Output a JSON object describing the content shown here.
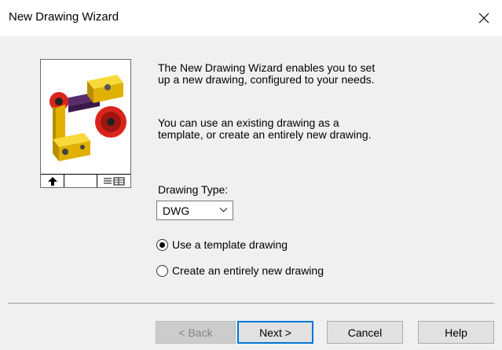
{
  "window": {
    "title": "New Drawing Wizard",
    "close_icon": "close-icon"
  },
  "preview": {
    "image_icon": "assembly-drawing-thumbnail",
    "titleblock_icons": [
      "north-arrow-icon",
      "notes-icon"
    ]
  },
  "description": {
    "paragraph1": "The New Drawing Wizard enables you to set up a new drawing, configured to your needs.",
    "paragraph2": "You can use an existing drawing as a template, or create an entirely new drawing."
  },
  "drawing_type": {
    "label": "Drawing Type:",
    "selected": "DWG"
  },
  "options": [
    {
      "label": "Use a template drawing",
      "selected": true
    },
    {
      "label": "Create an entirely new drawing",
      "selected": false
    }
  ],
  "buttons": {
    "back": "< Back",
    "next": "Next >",
    "cancel": "Cancel",
    "help": "Help"
  },
  "colors": {
    "accent": "#0078d7",
    "dialog_bg": "#f0f0f0",
    "part_yellow": "#f2c200",
    "part_red": "#d9251c",
    "part_purple": "#5a2d6e"
  }
}
